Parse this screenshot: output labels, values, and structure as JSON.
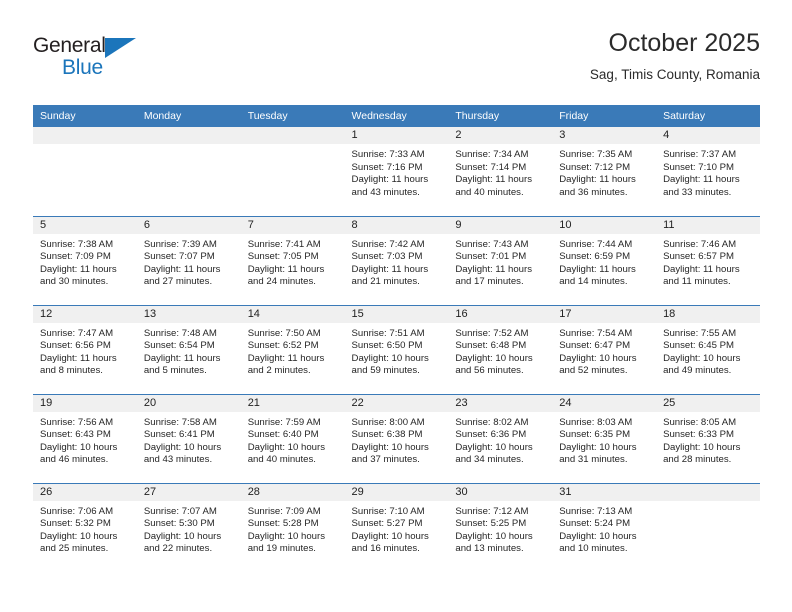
{
  "brand": {
    "name_part1": "General",
    "name_part2": "Blue",
    "triangle_icon": "triangle-icon",
    "accent_color": "#1b75bb"
  },
  "header": {
    "title": "October 2025",
    "subtitle": "Sag, Timis County, Romania"
  },
  "theme": {
    "header_blue": "#3a7ab8",
    "daynum_gray": "#f0f0f0",
    "text": "#262626"
  },
  "weekdays": [
    "Sunday",
    "Monday",
    "Tuesday",
    "Wednesday",
    "Thursday",
    "Friday",
    "Saturday"
  ],
  "labels": {
    "sunrise": "Sunrise:",
    "sunset": "Sunset:",
    "daylight": "Daylight:"
  },
  "weeks": [
    [
      {
        "day": "",
        "sunrise": "",
        "sunset": "",
        "daylight_line1": "",
        "daylight_line2": ""
      },
      {
        "day": "",
        "sunrise": "",
        "sunset": "",
        "daylight_line1": "",
        "daylight_line2": ""
      },
      {
        "day": "",
        "sunrise": "",
        "sunset": "",
        "daylight_line1": "",
        "daylight_line2": ""
      },
      {
        "day": "1",
        "sunrise": "Sunrise: 7:33 AM",
        "sunset": "Sunset: 7:16 PM",
        "daylight_line1": "Daylight: 11 hours",
        "daylight_line2": "and 43 minutes."
      },
      {
        "day": "2",
        "sunrise": "Sunrise: 7:34 AM",
        "sunset": "Sunset: 7:14 PM",
        "daylight_line1": "Daylight: 11 hours",
        "daylight_line2": "and 40 minutes."
      },
      {
        "day": "3",
        "sunrise": "Sunrise: 7:35 AM",
        "sunset": "Sunset: 7:12 PM",
        "daylight_line1": "Daylight: 11 hours",
        "daylight_line2": "and 36 minutes."
      },
      {
        "day": "4",
        "sunrise": "Sunrise: 7:37 AM",
        "sunset": "Sunset: 7:10 PM",
        "daylight_line1": "Daylight: 11 hours",
        "daylight_line2": "and 33 minutes."
      }
    ],
    [
      {
        "day": "5",
        "sunrise": "Sunrise: 7:38 AM",
        "sunset": "Sunset: 7:09 PM",
        "daylight_line1": "Daylight: 11 hours",
        "daylight_line2": "and 30 minutes."
      },
      {
        "day": "6",
        "sunrise": "Sunrise: 7:39 AM",
        "sunset": "Sunset: 7:07 PM",
        "daylight_line1": "Daylight: 11 hours",
        "daylight_line2": "and 27 minutes."
      },
      {
        "day": "7",
        "sunrise": "Sunrise: 7:41 AM",
        "sunset": "Sunset: 7:05 PM",
        "daylight_line1": "Daylight: 11 hours",
        "daylight_line2": "and 24 minutes."
      },
      {
        "day": "8",
        "sunrise": "Sunrise: 7:42 AM",
        "sunset": "Sunset: 7:03 PM",
        "daylight_line1": "Daylight: 11 hours",
        "daylight_line2": "and 21 minutes."
      },
      {
        "day": "9",
        "sunrise": "Sunrise: 7:43 AM",
        "sunset": "Sunset: 7:01 PM",
        "daylight_line1": "Daylight: 11 hours",
        "daylight_line2": "and 17 minutes."
      },
      {
        "day": "10",
        "sunrise": "Sunrise: 7:44 AM",
        "sunset": "Sunset: 6:59 PM",
        "daylight_line1": "Daylight: 11 hours",
        "daylight_line2": "and 14 minutes."
      },
      {
        "day": "11",
        "sunrise": "Sunrise: 7:46 AM",
        "sunset": "Sunset: 6:57 PM",
        "daylight_line1": "Daylight: 11 hours",
        "daylight_line2": "and 11 minutes."
      }
    ],
    [
      {
        "day": "12",
        "sunrise": "Sunrise: 7:47 AM",
        "sunset": "Sunset: 6:56 PM",
        "daylight_line1": "Daylight: 11 hours",
        "daylight_line2": "and 8 minutes."
      },
      {
        "day": "13",
        "sunrise": "Sunrise: 7:48 AM",
        "sunset": "Sunset: 6:54 PM",
        "daylight_line1": "Daylight: 11 hours",
        "daylight_line2": "and 5 minutes."
      },
      {
        "day": "14",
        "sunrise": "Sunrise: 7:50 AM",
        "sunset": "Sunset: 6:52 PM",
        "daylight_line1": "Daylight: 11 hours",
        "daylight_line2": "and 2 minutes."
      },
      {
        "day": "15",
        "sunrise": "Sunrise: 7:51 AM",
        "sunset": "Sunset: 6:50 PM",
        "daylight_line1": "Daylight: 10 hours",
        "daylight_line2": "and 59 minutes."
      },
      {
        "day": "16",
        "sunrise": "Sunrise: 7:52 AM",
        "sunset": "Sunset: 6:48 PM",
        "daylight_line1": "Daylight: 10 hours",
        "daylight_line2": "and 56 minutes."
      },
      {
        "day": "17",
        "sunrise": "Sunrise: 7:54 AM",
        "sunset": "Sunset: 6:47 PM",
        "daylight_line1": "Daylight: 10 hours",
        "daylight_line2": "and 52 minutes."
      },
      {
        "day": "18",
        "sunrise": "Sunrise: 7:55 AM",
        "sunset": "Sunset: 6:45 PM",
        "daylight_line1": "Daylight: 10 hours",
        "daylight_line2": "and 49 minutes."
      }
    ],
    [
      {
        "day": "19",
        "sunrise": "Sunrise: 7:56 AM",
        "sunset": "Sunset: 6:43 PM",
        "daylight_line1": "Daylight: 10 hours",
        "daylight_line2": "and 46 minutes."
      },
      {
        "day": "20",
        "sunrise": "Sunrise: 7:58 AM",
        "sunset": "Sunset: 6:41 PM",
        "daylight_line1": "Daylight: 10 hours",
        "daylight_line2": "and 43 minutes."
      },
      {
        "day": "21",
        "sunrise": "Sunrise: 7:59 AM",
        "sunset": "Sunset: 6:40 PM",
        "daylight_line1": "Daylight: 10 hours",
        "daylight_line2": "and 40 minutes."
      },
      {
        "day": "22",
        "sunrise": "Sunrise: 8:00 AM",
        "sunset": "Sunset: 6:38 PM",
        "daylight_line1": "Daylight: 10 hours",
        "daylight_line2": "and 37 minutes."
      },
      {
        "day": "23",
        "sunrise": "Sunrise: 8:02 AM",
        "sunset": "Sunset: 6:36 PM",
        "daylight_line1": "Daylight: 10 hours",
        "daylight_line2": "and 34 minutes."
      },
      {
        "day": "24",
        "sunrise": "Sunrise: 8:03 AM",
        "sunset": "Sunset: 6:35 PM",
        "daylight_line1": "Daylight: 10 hours",
        "daylight_line2": "and 31 minutes."
      },
      {
        "day": "25",
        "sunrise": "Sunrise: 8:05 AM",
        "sunset": "Sunset: 6:33 PM",
        "daylight_line1": "Daylight: 10 hours",
        "daylight_line2": "and 28 minutes."
      }
    ],
    [
      {
        "day": "26",
        "sunrise": "Sunrise: 7:06 AM",
        "sunset": "Sunset: 5:32 PM",
        "daylight_line1": "Daylight: 10 hours",
        "daylight_line2": "and 25 minutes."
      },
      {
        "day": "27",
        "sunrise": "Sunrise: 7:07 AM",
        "sunset": "Sunset: 5:30 PM",
        "daylight_line1": "Daylight: 10 hours",
        "daylight_line2": "and 22 minutes."
      },
      {
        "day": "28",
        "sunrise": "Sunrise: 7:09 AM",
        "sunset": "Sunset: 5:28 PM",
        "daylight_line1": "Daylight: 10 hours",
        "daylight_line2": "and 19 minutes."
      },
      {
        "day": "29",
        "sunrise": "Sunrise: 7:10 AM",
        "sunset": "Sunset: 5:27 PM",
        "daylight_line1": "Daylight: 10 hours",
        "daylight_line2": "and 16 minutes."
      },
      {
        "day": "30",
        "sunrise": "Sunrise: 7:12 AM",
        "sunset": "Sunset: 5:25 PM",
        "daylight_line1": "Daylight: 10 hours",
        "daylight_line2": "and 13 minutes."
      },
      {
        "day": "31",
        "sunrise": "Sunrise: 7:13 AM",
        "sunset": "Sunset: 5:24 PM",
        "daylight_line1": "Daylight: 10 hours",
        "daylight_line2": "and 10 minutes."
      },
      {
        "day": "",
        "sunrise": "",
        "sunset": "",
        "daylight_line1": "",
        "daylight_line2": ""
      }
    ]
  ]
}
